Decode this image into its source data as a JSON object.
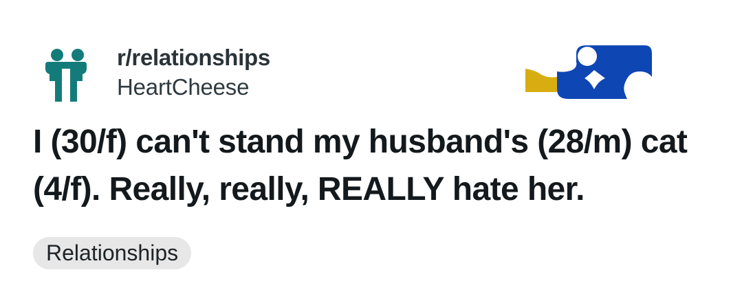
{
  "community": {
    "name": "r/relationships",
    "avatar_icon": "two-people-icon",
    "avatar_color": "#137c7a"
  },
  "author": {
    "username": "HeartCheese"
  },
  "post": {
    "title": "I (30/f) can't stand my husband's (28/m) cat (4/f). Really, really, REALLY hate her.",
    "flair": "Relationships"
  },
  "colors": {
    "title_text": "#13191c",
    "flair_background": "#e7e7e7",
    "graphic_blue": "#0e46b4",
    "graphic_gold": "#d8ad12"
  }
}
